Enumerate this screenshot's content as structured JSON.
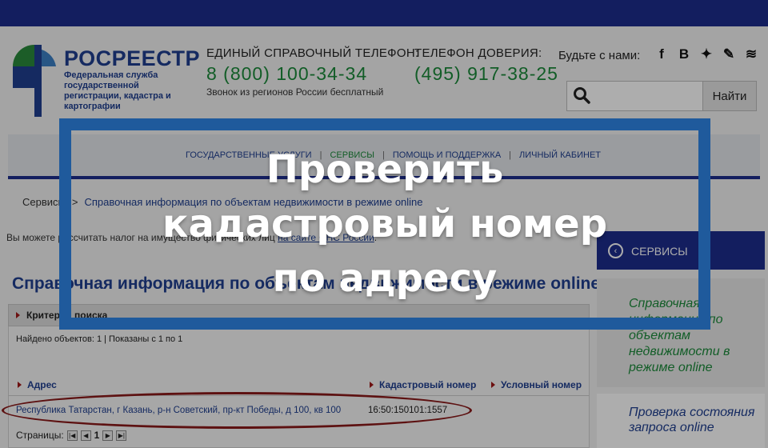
{
  "header": {
    "logo_title": "РОСРЕЕСТР",
    "logo_subtitle": "Федеральная служба государственной регистрации, кадастра и картографии",
    "phone1_label": "ЕДИНЫЙ СПРАВОЧНЫЙ ТЕЛЕФОН:",
    "phone1_number": "8 (800) 100-34-34",
    "phone1_note": "Звонок из регионов России бесплатный",
    "phone2_label": "ТЕЛЕФОН ДОВЕРИЯ:",
    "phone2_number": "(495) 917-38-25",
    "social_label": "Будьте с нами:",
    "social_icons": [
      "facebook-icon",
      "vk-icon",
      "twitter-icon",
      "livejournal-icon",
      "rss-icon"
    ],
    "social_glyphs": [
      "f",
      "B",
      "✦",
      "✎",
      "≋"
    ],
    "search_button": "Найти"
  },
  "nav": {
    "items": [
      {
        "label": "ГОСУДАРСТВЕННЫЕ УСЛУГИ",
        "active": false
      },
      {
        "label": "СЕРВИСЫ",
        "active": true
      },
      {
        "label": "ПОМОЩЬ И ПОДДЕРЖКА",
        "active": false
      },
      {
        "label": "ЛИЧНЫЙ КАБИНЕТ",
        "active": false
      }
    ],
    "separator": "|"
  },
  "breadcrumb": {
    "root": "Сервисы",
    "sep": ">",
    "current": "Справочная информация по объектам недвижимости в режиме online"
  },
  "tax_note": {
    "text": "Вы можете рассчитать налог на имущество физических лиц",
    "link": "на сайте ФНС России",
    "end": "."
  },
  "page_title": "Справочная информация по объектам недвижимости в режиме online",
  "results": {
    "criteria_label": "Критерии поиска",
    "found_text": "Найдено объектов: 1 | Показаны с 1 по 1",
    "columns": {
      "address": "Адрес",
      "cadastral": "Кадастровый номер",
      "conditional": "Условный номер"
    },
    "rows": [
      {
        "address": "Республика Татарстан, г Казань, р-н Советский, пр-кт Победы, д 100, кв 100",
        "cadastral": "16:50:150101:1557"
      }
    ],
    "pages_label": "Страницы:",
    "current_page": "1",
    "pager": {
      "first": "|◀",
      "prev": "◀",
      "next": "▶",
      "last": "▶|"
    }
  },
  "sidebar": {
    "header": "СЕРВИСЫ",
    "back_glyph": "‹",
    "items": [
      "Справочная информация по объектам недвижимости в режиме online",
      "Проверка состояния запроса online"
    ]
  },
  "overlay": {
    "line1": "Проверить",
    "line2": "кадастровый номер",
    "line3": "по адресу",
    "frame_color": "#1f5a9c"
  }
}
